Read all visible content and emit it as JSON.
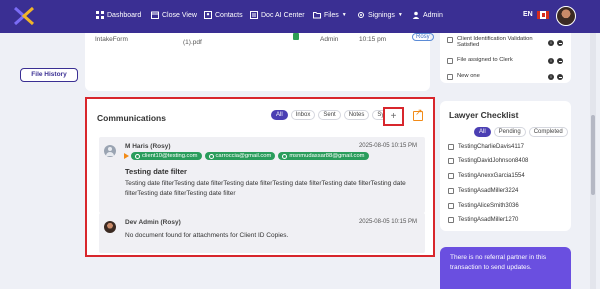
{
  "nav": {
    "items": [
      {
        "label": "Dashboard",
        "icon": "dashboard-icon"
      },
      {
        "label": "Close View",
        "icon": "calendar-icon"
      },
      {
        "label": "Contacts",
        "icon": "contacts-icon"
      },
      {
        "label": "Doc AI Center",
        "icon": "doc-ai-icon"
      },
      {
        "label": "Files",
        "icon": "files-icon",
        "dropdown": true
      },
      {
        "label": "Signings",
        "icon": "signings-icon",
        "dropdown": true
      },
      {
        "label": "Admin",
        "icon": "admin-icon"
      }
    ],
    "lang": "EN"
  },
  "left": {
    "file_history": "File History"
  },
  "doc_row": {
    "name": "IntakeForm",
    "file": "(1).pdf",
    "user": "Admin",
    "time": "10:15 pm",
    "badge": "Rosy"
  },
  "communications": {
    "title": "Communications",
    "tabs": [
      "All",
      "Inbox",
      "Sent",
      "Notes",
      "System"
    ],
    "add_label": "+",
    "messages": [
      {
        "sender": "M Haris (Rosy)",
        "time": "2025-08-05 10:15 PM",
        "recipients": [
          "client10@testing.com",
          "carroccia@gmail.com",
          "msnmudassar88@gmail.com"
        ],
        "subject": "Testing date filter",
        "body": "Testing date filterTesting date filterTesting date filterTesting date filterTesting date filterTesting date filterTesting date filterTesting date filter"
      },
      {
        "sender": "Dev Admin (Rosy)",
        "time": "2025-08-05 10:15 PM",
        "body": "No document found for attachments for Client ID Copies."
      }
    ]
  },
  "checklist_top": {
    "items": [
      "Client Identification Validation Satisfied",
      "File assigned to Clerk",
      "New one"
    ]
  },
  "lawyer_checklist": {
    "title": "Lawyer Checklist",
    "tabs": [
      "All",
      "Pending",
      "Completed"
    ],
    "items": [
      "TestingCharlieDavis4117",
      "TestingDavidJohnson8408",
      "TestingAnexxGarcia1554",
      "TestingAsadMiller3224",
      "TestingAliceSmith3036",
      "TestingAsadMiller1270"
    ]
  },
  "referral": {
    "text": "There is no referral partner in this transaction to send updates."
  },
  "colors": {
    "nav": "#3a2f93",
    "accent": "#4b3fb3",
    "chip": "#2a9d5c",
    "highlight": "#d8262c",
    "referral": "#6a4fe0"
  }
}
